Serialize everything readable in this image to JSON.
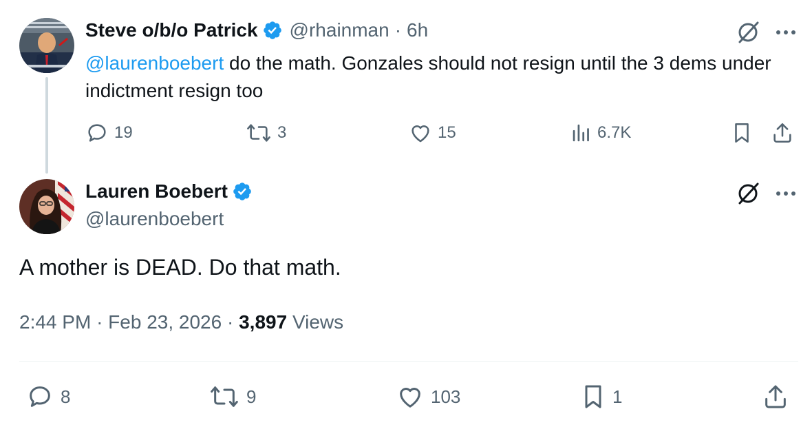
{
  "reply": {
    "author_name": "Steve o/b/o Patrick",
    "handle": "@rhainman",
    "separator": "·",
    "time": "6h",
    "mention": "@laurenboebert",
    "text": " do the math. Gonzales should not resign until the 3 dems under indictment resign too",
    "stats": {
      "replies": "19",
      "reposts": "3",
      "likes": "15",
      "views": "6.7K"
    }
  },
  "main": {
    "author_name": "Lauren Boebert",
    "handle": "@laurenboebert",
    "text": "A mother is DEAD. Do that math.",
    "time": "2:44 PM",
    "separator": "·",
    "date": "Feb 23, 2026",
    "views_count": "3,897",
    "views_label": "Views",
    "stats": {
      "replies": "8",
      "reposts": "9",
      "likes": "103",
      "bookmarks": "1"
    }
  },
  "icons": {
    "verified": "verified-badge-icon",
    "grok": "grok-icon",
    "more": "more-icon",
    "reply": "reply-icon",
    "repost": "repost-icon",
    "like": "like-icon",
    "views": "views-icon",
    "bookmark": "bookmark-icon",
    "share": "share-icon"
  },
  "colors": {
    "accent": "#1d9bf0",
    "text": "#0f1419",
    "secondary": "#536471",
    "thread_line": "#cfd9de"
  }
}
